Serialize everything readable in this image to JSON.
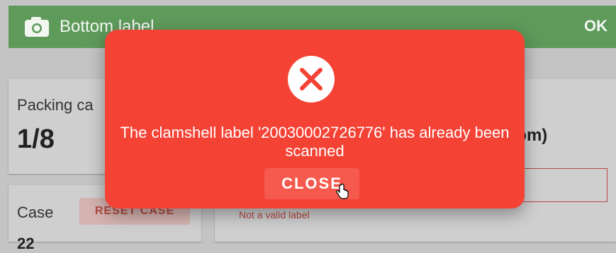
{
  "appbar": {
    "title": "Bottom label",
    "ok_label": "OK",
    "icon": "camera-icon",
    "color": "#5e9b5b"
  },
  "packing": {
    "label": "Packing ca",
    "count": "1/8"
  },
  "case": {
    "label": "Case",
    "reset_label": "RESET CASE",
    "value": "22"
  },
  "scan_panel": {
    "heading": "pottom)",
    "input_value": "",
    "error_text": "Not a valid label"
  },
  "dialog": {
    "icon": "error-x-icon",
    "message": "The clamshell label '20030002726776' has already been scanned",
    "close_label": "CLOSE",
    "color": "#f44235"
  }
}
